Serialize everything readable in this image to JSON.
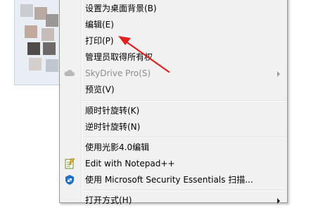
{
  "menu": {
    "items": [
      {
        "label": "设置为桌面背景(B)",
        "disabled": false,
        "submenu": false
      },
      {
        "label": "编辑(E)",
        "disabled": false,
        "submenu": false
      },
      {
        "label": "打印(P)",
        "disabled": false,
        "submenu": false
      },
      {
        "label": "管理员取得所有权",
        "disabled": false,
        "submenu": false
      },
      {
        "label": "SkyDrive Pro(S)",
        "disabled": true,
        "submenu": true,
        "icon": "cloud-icon"
      },
      {
        "label": "预览(V)",
        "disabled": false,
        "submenu": false
      },
      {
        "label": "顺时针旋转(K)",
        "disabled": false,
        "submenu": false
      },
      {
        "label": "逆时针旋转(N)",
        "disabled": false,
        "submenu": false
      },
      {
        "label": "使用光影4.0编辑",
        "disabled": false,
        "submenu": false
      },
      {
        "label": "Edit with Notepad++",
        "disabled": false,
        "submenu": false,
        "icon": "notepadpp-icon"
      },
      {
        "label": "使用 Microsoft Security Essentials 扫描...",
        "disabled": false,
        "submenu": false,
        "icon": "mse-shield-icon"
      },
      {
        "label": "打开方式(H)",
        "disabled": false,
        "submenu": true
      }
    ]
  },
  "annotation": {
    "color": "#e02020",
    "points_to": "打印(P)"
  }
}
